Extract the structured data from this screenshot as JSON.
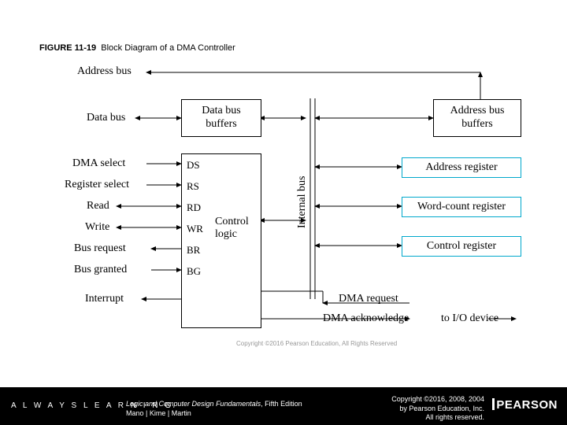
{
  "figure": {
    "number": "FIGURE 11-19",
    "caption": "Block Diagram of a DMA Controller"
  },
  "labels": {
    "address_bus": "Address bus",
    "data_bus": "Data bus",
    "internal_bus": "Internal bus",
    "dma_select": "DMA select",
    "register_select": "Register select",
    "read": "Read",
    "write": "Write",
    "bus_request": "Bus request",
    "bus_granted": "Bus granted",
    "interrupt": "Interrupt",
    "dma_request": "DMA request",
    "dma_ack": "DMA acknowledge",
    "to_io": "to I/O device"
  },
  "blocks": {
    "data_bus_buffers": "Data bus\nbuffers",
    "address_bus_buffers": "Address bus\nbuffers",
    "address_register": "Address register",
    "word_count_register": "Word-count register",
    "control_register": "Control register",
    "control_logic": "Control\nlogic"
  },
  "pins": {
    "ds": "DS",
    "rs": "RS",
    "rd": "RD",
    "wr": "WR",
    "br": "BR",
    "bg": "BG"
  },
  "inner_copyright": "Copyright ©2016 Pearson Education, All Rights Reserved",
  "footer": {
    "always": "A L W A Y S  L E A R N I N G",
    "book_title": "Logic and Computer Design Fundamentals",
    "book_edition": ", Fifth Edition",
    "authors": "Mano | Kime | Martin",
    "copyright_l1": "Copyright ©2016, 2008, 2004",
    "copyright_l2": "by Pearson Education, Inc.",
    "copyright_l3": "All rights reserved.",
    "brand": "PEARSON"
  }
}
